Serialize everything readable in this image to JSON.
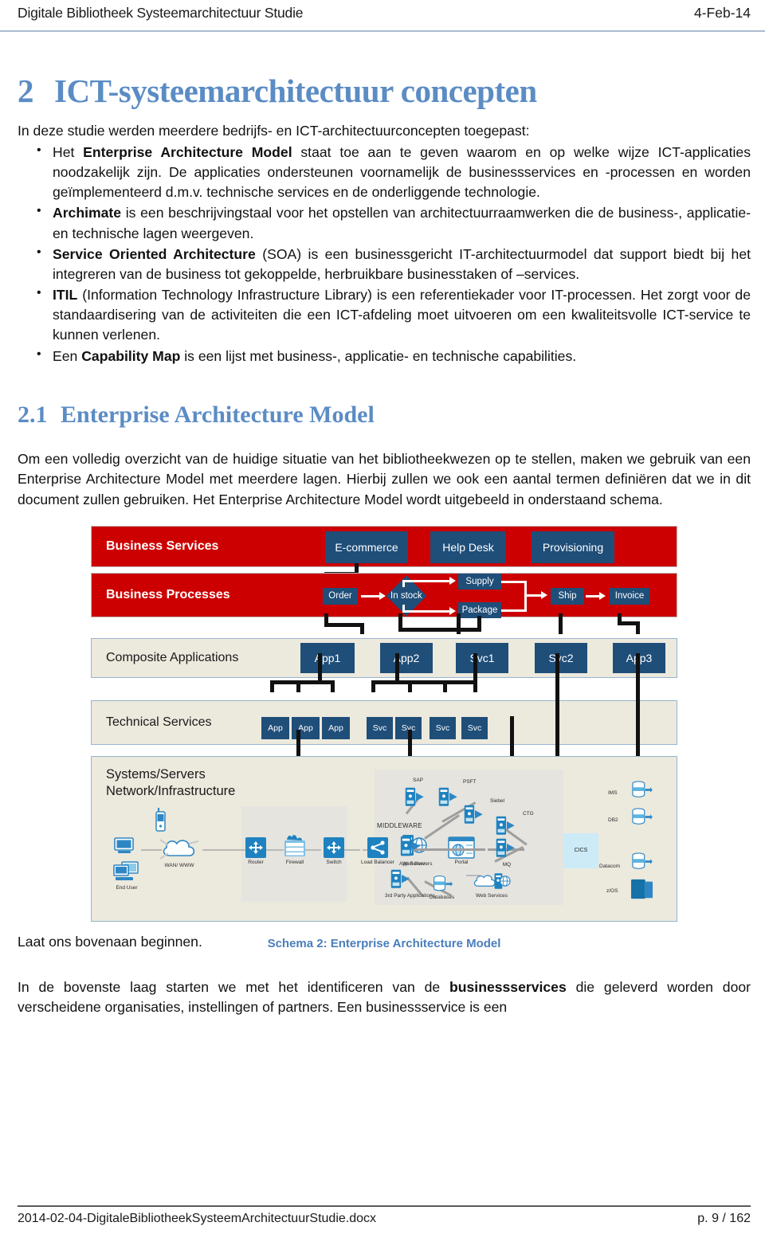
{
  "header": {
    "title": "Digitale Bibliotheek Systeemarchitectuur Studie",
    "date": "4-Feb-14"
  },
  "chapter": {
    "number": "2",
    "title": "ICT-systeemarchitectuur concepten",
    "intro": "In deze studie werden meerdere bedrijfs- en ICT-architectuurconcepten toegepast:",
    "bullets": [
      {
        "lead": "Het ",
        "bold": "Enterprise Architecture Model",
        "rest": " staat toe aan te geven waarom en op welke wijze ICT-applicaties noodzakelijk zijn. De applicaties ondersteunen voornamelijk de businessservices en -processen en worden geïmplementeerd d.m.v. technische services en de onderliggende technologie."
      },
      {
        "lead": "",
        "bold": "Archimate",
        "rest": " is een beschrijvingstaal voor het opstellen van architectuurraamwerken die de business-, applicatie- en technische lagen weergeven."
      },
      {
        "lead": "",
        "bold": "Service Oriented Architecture",
        "rest": " (SOA) is een businessgericht IT-architectuurmodel dat support biedt bij het integreren van de business tot gekoppelde, herbruikbare businesstaken of –services."
      },
      {
        "lead": "",
        "bold": "ITIL",
        "rest": " (Information Technology Infrastructure Library) is een referentiekader voor IT-processen. Het zorgt voor de standaardisering van de activiteiten die een ICT-afdeling moet uitvoeren om een kwaliteitsvolle ICT-service te kunnen verlenen."
      },
      {
        "lead": "Een ",
        "bold": "Capability Map",
        "rest": " is een lijst met business-, applicatie- en technische capabilities."
      }
    ]
  },
  "section": {
    "number": "2.1",
    "title": "Enterprise Architecture Model",
    "paragraph": "Om een volledig overzicht van de huidige situatie van het bibliotheekwezen op te stellen, maken we gebruik van een Enterprise Architecture Model met meerdere lagen. Hierbij zullen we ook een aantal termen definiëren dat we in dit document zullen gebruiken. Het Enterprise Architecture Model wordt uitgebeeld in onderstaand schema."
  },
  "figure": {
    "caption": "Schema 2: Enterprise Architecture Model",
    "colors": {
      "band_red": "#cc0000",
      "band_beige": "#ece9dd",
      "box_blue": "#1f4e79",
      "band_border_blue": "#97b4cf",
      "caption_blue": "#4a7ebb"
    },
    "bands": [
      {
        "label": "Business Services"
      },
      {
        "label": "Business Processes"
      },
      {
        "label": "Composite Applications"
      },
      {
        "label": "Technical Services"
      },
      {
        "label_line1": "Systems/Servers",
        "label_line2": "Network/Infrastructure"
      }
    ],
    "business_services": [
      "E-commerce",
      "Help Desk",
      "Provisioning"
    ],
    "business_processes": {
      "order": "Order",
      "decision": "In stock",
      "supply": "Supply",
      "package": "Package",
      "ship": "Ship",
      "invoice": "Invoice"
    },
    "composite_applications": [
      "App1",
      "App2",
      "Svc1",
      "Svc2",
      "App3"
    ],
    "technical_services": {
      "apps": [
        "App",
        "App",
        "App"
      ],
      "svcs": [
        "Svc",
        "Svc",
        "Svc",
        "Svc"
      ]
    },
    "infrastructure": {
      "network": [
        {
          "name": "End User",
          "icon": "desktop-icon"
        },
        {
          "name": "WAN/ WWW",
          "icon": "cloud-icon"
        },
        {
          "name": "Router",
          "icon": "router-icon"
        },
        {
          "name": "Firewall",
          "icon": "firewall-icon"
        },
        {
          "name": "Switch",
          "icon": "switch-icon"
        },
        {
          "name": "Load Balancer",
          "icon": "load-balancer-icon"
        },
        {
          "name": "Web Servers",
          "icon": "server-icon"
        }
      ],
      "mobile": "mobile-icon",
      "portal": "Portal",
      "middleware_label": "MIDDLEWARE",
      "middleware": [
        {
          "name": "App Server",
          "icon": "server-icon"
        },
        {
          "name": "3rd Party Applications",
          "icon": "server-icon"
        },
        {
          "name": "Databases",
          "icon": "database-icon"
        },
        {
          "name": "Web Services",
          "icon": "web-service-icon"
        },
        {
          "name": "SAP",
          "icon": "server-icon"
        },
        {
          "name": "PSFT",
          "icon": "server-icon"
        },
        {
          "name": "Siebel",
          "icon": "server-icon"
        },
        {
          "name": "CTG",
          "icon": "server-icon"
        },
        {
          "name": "MQ",
          "icon": "server-icon"
        }
      ],
      "cics": "CICS",
      "mainframe": [
        {
          "name": "IMS",
          "icon": "database-icon"
        },
        {
          "name": "DB2",
          "icon": "database-icon"
        },
        {
          "name": "Datacom",
          "icon": "database-icon"
        },
        {
          "name": "z/OS",
          "icon": "mainframe-icon"
        }
      ]
    }
  },
  "after_figure": {
    "laat_ons": "Laat ons bovenaan beginnen.",
    "paragraph_pre": "In de bovenste laag starten we met het identificeren van de ",
    "paragraph_bold": "businessservices",
    "paragraph_post": " die geleverd worden door verscheidene organisaties, instellingen of partners. Een businessservice is een"
  },
  "footer": {
    "filename": "2014-02-04-DigitaleBibliotheekSysteemArchitectuurStudie.docx",
    "page": "p. 9 / 162"
  }
}
